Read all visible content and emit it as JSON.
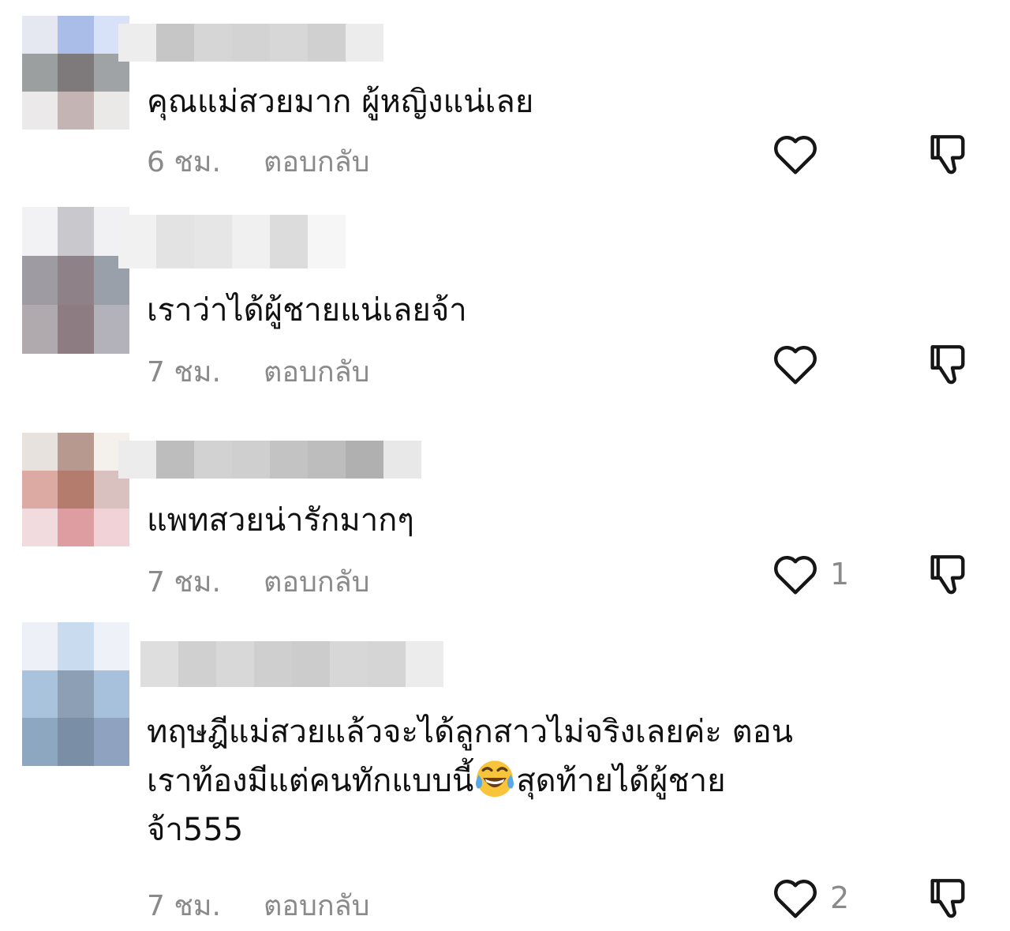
{
  "comments": [
    {
      "avatar_colors": [
        "#e6e8f1",
        "#a9bde8",
        "#d7e1f8",
        "#9c9fa0",
        "#7e7a7c",
        "#a0a3a6",
        "#ebe9e9",
        "#c4b5b4",
        "#ebe8e8"
      ],
      "name_colors": [
        "#ededed",
        "#c6c6c6",
        "#d6d6d6",
        "#d3d3d3",
        "#d7d7d7",
        "#d0d0d0",
        "#ececec"
      ],
      "text": "คุณแม่สวยมาก ผู้หญิงแน่เลย",
      "time": "6 ชม.",
      "reply": "ตอบกลับ",
      "likes": ""
    },
    {
      "avatar_colors": [
        "#f2f2f4",
        "#c9c8cc",
        "#f1f1f3",
        "#9f9ba3",
        "#8e8288",
        "#9aa0aa",
        "#b0a9ad",
        "#8d7c82",
        "#b3b2ba"
      ],
      "name_colors": [
        "#f1f1f1",
        "#e3e3e3",
        "#e6e6e6",
        "#f0f0f0",
        "#dcdcdc",
        "#f6f6f6"
      ],
      "text": "เราว่าได้ผู้ชายแน่เลยจ้า",
      "time": "7 ชม.",
      "reply": "ตอบกลับ",
      "likes": ""
    },
    {
      "avatar_colors": [
        "#e7e2de",
        "#b8998f",
        "#f4f0ec",
        "#dca9a3",
        "#b37c6d",
        "#d9c1bf",
        "#f1dbdf",
        "#dd9da1",
        "#f0d2d7"
      ],
      "name_colors": [
        "#ececec",
        "#bdbdbd",
        "#d2d2d2",
        "#cfcfcf",
        "#c3c3c3",
        "#bdbdbd",
        "#b0b0b0",
        "#e8e8e8"
      ],
      "text": "แพทสวยน่ารักมากๆ",
      "time": "7 ชม.",
      "reply": "ตอบกลับ",
      "likes": "1"
    },
    {
      "avatar_colors": [
        "#edf1f7",
        "#c9dbef",
        "#eef2f8",
        "#a9c3dc",
        "#8c9fb5",
        "#a7c0dc",
        "#8ea7c1",
        "#7a8fa6",
        "#8fa3c0"
      ],
      "name_colors": [
        "#dedede",
        "#d0d0d0",
        "#d8d8d8",
        "#cfcfcf",
        "#cccccc",
        "#d7d7d7",
        "#d5d5d5",
        "#ececec"
      ],
      "text_line1": "ทฤษฎีแม่สวยแล้วจะได้ลูกสาวไม่จริงเลยค่ะ ตอน",
      "text_line2a": "เราท้องมีแต่คนทักแบบนี้",
      "text_line2b": "สุดท้ายได้ผู้ชาย",
      "text_line3": "จ้า555",
      "emoji": "face-with-tears-of-joy",
      "time": "7 ชม.",
      "reply": "ตอบกลับ",
      "likes": "2"
    }
  ],
  "icons": {
    "like": "heart-outline-icon",
    "dislike": "thumbs-down-outline-icon"
  }
}
